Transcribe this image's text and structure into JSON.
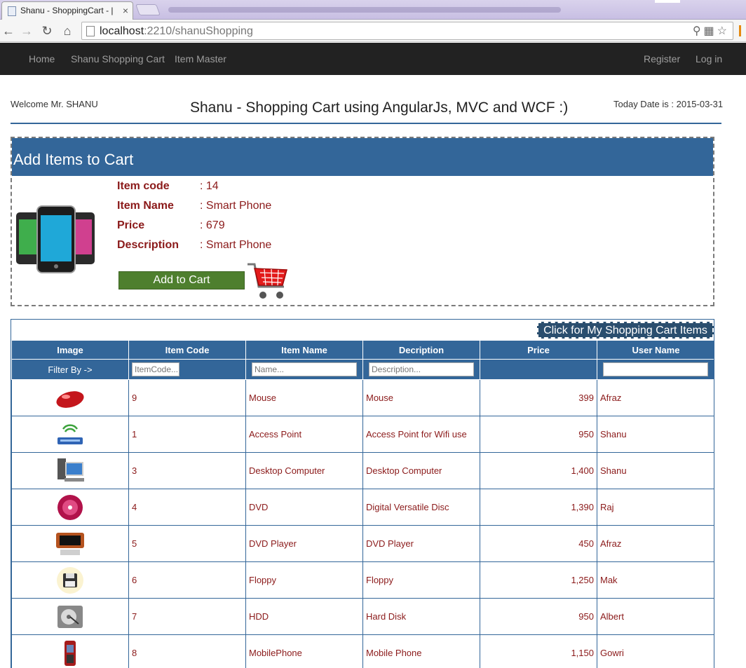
{
  "browser": {
    "tab_title": "Shanu - ShoppingCart - |",
    "tab_close": "×",
    "url_host": "localhost",
    "url_path": ":2210/shanuShopping",
    "icons": [
      "back-icon",
      "forward-icon",
      "reload-icon",
      "home-icon",
      "zoom-icon",
      "translate-icon",
      "star-icon"
    ]
  },
  "nav": {
    "links": [
      "Home",
      "Shanu Shopping Cart",
      "Item Master"
    ],
    "right_links": [
      "Register",
      "Log in"
    ]
  },
  "header": {
    "welcome": "Welcome Mr. SHANU",
    "title": "Shanu - Shopping Cart using AngularJs, MVC and WCF :)",
    "today": "Today Date is : 2015-03-31"
  },
  "add_panel": {
    "heading": "Add Items to Cart",
    "fields": [
      {
        "label": "Item code",
        "value": ": 14"
      },
      {
        "label": "Item Name",
        "value": ": Smart Phone"
      },
      {
        "label": "Price",
        "value": ": 679"
      },
      {
        "label": "Description",
        "value": ": Smart Phone"
      }
    ],
    "add_button": "Add to Cart"
  },
  "grid": {
    "cart_link": "Click for My Shopping Cart Items",
    "columns": [
      "Image",
      "Item Code",
      "Item Name",
      "Decription",
      "Price",
      "User Name"
    ],
    "filter_label": "Filter By ->",
    "filter_placeholders": {
      "code": "ItemCode...",
      "name": "Name...",
      "description": "Description...",
      "user": ""
    },
    "rows": [
      {
        "image": "mouse-image",
        "code": "9",
        "name": "Mouse",
        "description": "Mouse",
        "price": "399",
        "user": "Afraz"
      },
      {
        "image": "access-point-image",
        "code": "1",
        "name": "Access Point",
        "description": "Access Point for Wifi use",
        "price": "950",
        "user": "Shanu"
      },
      {
        "image": "desktop-computer-image",
        "code": "3",
        "name": "Desktop Computer",
        "description": "Desktop Computer",
        "price": "1,400",
        "user": "Shanu"
      },
      {
        "image": "dvd-image",
        "code": "4",
        "name": "DVD",
        "description": "Digital Versatile Disc",
        "price": "1,390",
        "user": "Raj"
      },
      {
        "image": "dvd-player-image",
        "code": "5",
        "name": "DVD Player",
        "description": "DVD Player",
        "price": "450",
        "user": "Afraz"
      },
      {
        "image": "floppy-image",
        "code": "6",
        "name": "Floppy",
        "description": "Floppy",
        "price": "1,250",
        "user": "Mak"
      },
      {
        "image": "hdd-image",
        "code": "7",
        "name": "HDD",
        "description": "Hard Disk",
        "price": "950",
        "user": "Albert"
      },
      {
        "image": "mobile-phone-image",
        "code": "8",
        "name": "MobilePhone",
        "description": "Mobile Phone",
        "price": "1,150",
        "user": "Gowri"
      }
    ]
  }
}
